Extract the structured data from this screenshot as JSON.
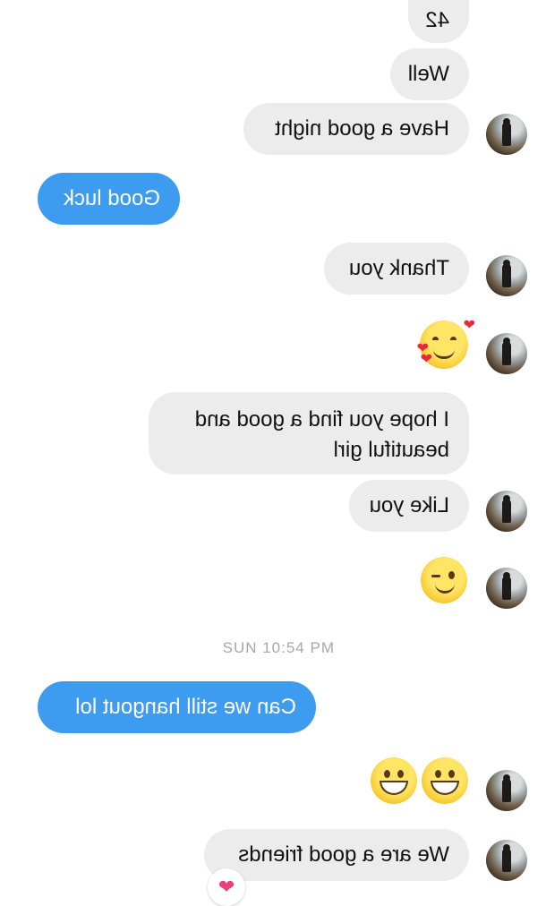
{
  "messages": {
    "m1": "42",
    "m2": "Well",
    "m3": "Have a good night",
    "m4": "Good luck",
    "m5": "Thank you",
    "m6": "I hope you find a good and beautiful girl",
    "m7": "Like you",
    "m8": "Can we still hangout lol",
    "m9": "We are a good friends"
  },
  "timestamp": "SUN 10:54 PM",
  "emoji_names": {
    "smiling_hearts": "smiling-face-with-hearts-emoji",
    "wink": "winking-face-emoji",
    "grin": "grinning-face-emoji"
  },
  "reaction_icon": "heart-reaction-icon",
  "colors": {
    "incoming_bubble": "#ececec",
    "outgoing_bubble": "#3e9cf0",
    "timestamp": "#a7a7ac"
  }
}
